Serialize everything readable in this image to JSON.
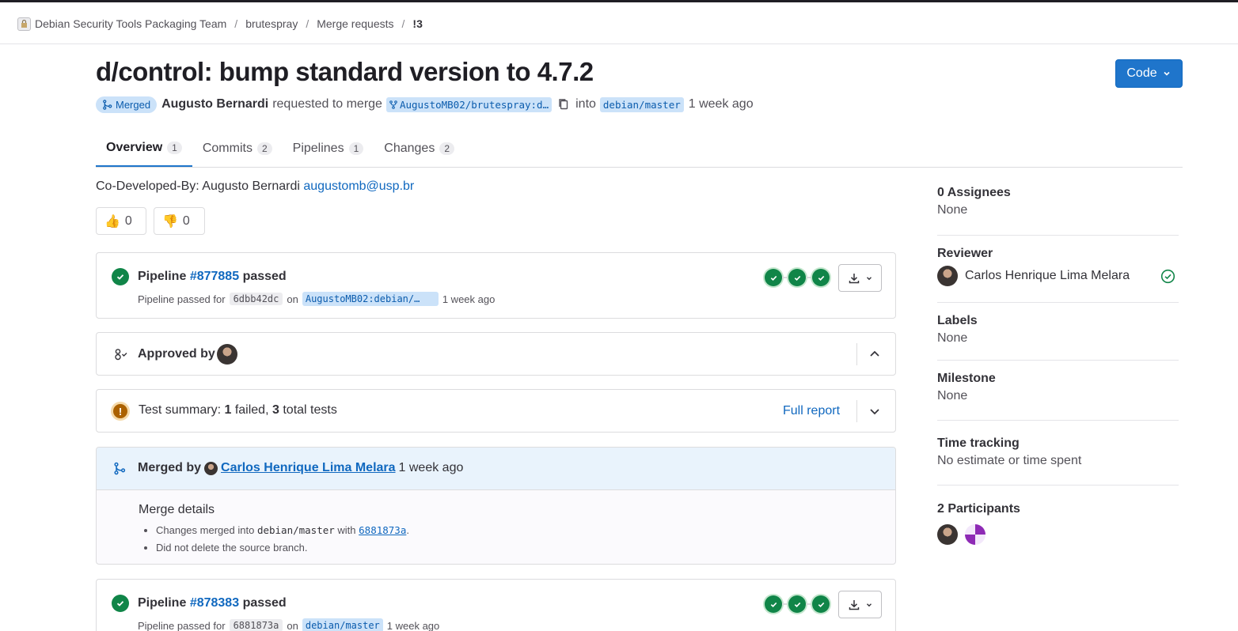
{
  "breadcrumb": {
    "items": [
      "Debian Security Tools Packaging Team",
      "brutespray",
      "Merge requests",
      "!3"
    ]
  },
  "mr": {
    "title": "d/control: bump standard version to 4.7.2",
    "status": "Merged",
    "author": "Augusto Bernardi",
    "requested_text": "requested to merge",
    "source_branch": "AugustoMB02/brutespray:d…",
    "into_text": "into",
    "target_branch": "debian/master",
    "time": "1 week ago"
  },
  "code_button": {
    "label": "Code"
  },
  "tabs": [
    {
      "label": "Overview",
      "count": "1"
    },
    {
      "label": "Commits",
      "count": "2"
    },
    {
      "label": "Pipelines",
      "count": "1"
    },
    {
      "label": "Changes",
      "count": "2"
    }
  ],
  "description": {
    "text": "Co-Developed-By: Augusto Bernardi",
    "email": "augustomb@usp.br"
  },
  "reactions": {
    "thumbs_up": {
      "emoji": "👍",
      "count": "0"
    },
    "thumbs_down": {
      "emoji": "👎",
      "count": "0"
    }
  },
  "pipeline1": {
    "label": "Pipeline",
    "id": "#877885",
    "status": "passed",
    "sub_text": "Pipeline passed for",
    "sha": "6dbb42dc",
    "on": "on",
    "ref": "AugustoMB02:debian/…",
    "time": "1 week ago"
  },
  "approvals": {
    "label": "Approved by"
  },
  "tests": {
    "prefix": "Test summary:",
    "failed_count": "1",
    "failed_label": "failed,",
    "total_count": "3",
    "total_label": "total tests",
    "full_report": "Full report"
  },
  "merged": {
    "label": "Merged by",
    "user": "Carlos Henrique Lima Melara",
    "time": "1 week ago",
    "details_title": "Merge details",
    "detail1_pre": "Changes merged into",
    "detail1_branch": "debian/master",
    "detail1_with": "with",
    "detail1_sha": "6881873a",
    "detail1_end": ".",
    "detail2": "Did not delete the source branch."
  },
  "pipeline2": {
    "label": "Pipeline",
    "id": "#878383",
    "status": "passed",
    "sub_text": "Pipeline passed for",
    "sha": "6881873a",
    "on": "on",
    "ref": "debian/master",
    "time": "1 week ago"
  },
  "sidebar": {
    "assignees": {
      "title": "0 Assignees",
      "value": "None"
    },
    "reviewer": {
      "title": "Reviewer",
      "name": "Carlos Henrique Lima Melara"
    },
    "labels": {
      "title": "Labels",
      "value": "None"
    },
    "milestone": {
      "title": "Milestone",
      "value": "None"
    },
    "time_tracking": {
      "title": "Time tracking",
      "value": "No estimate or time spent"
    },
    "participants": {
      "title": "2 Participants"
    }
  },
  "colors": {
    "accent": "#1f75cb",
    "success": "#108548",
    "warning": "#ab6100",
    "merged_bg": "#e9f3fc"
  },
  "icons": [
    "merge-icon",
    "fork-icon",
    "copy-icon",
    "chevron-down-icon",
    "check-icon",
    "download-icon",
    "approval-icon",
    "chevron-up-icon",
    "warning-icon",
    "check-circle-icon"
  ]
}
